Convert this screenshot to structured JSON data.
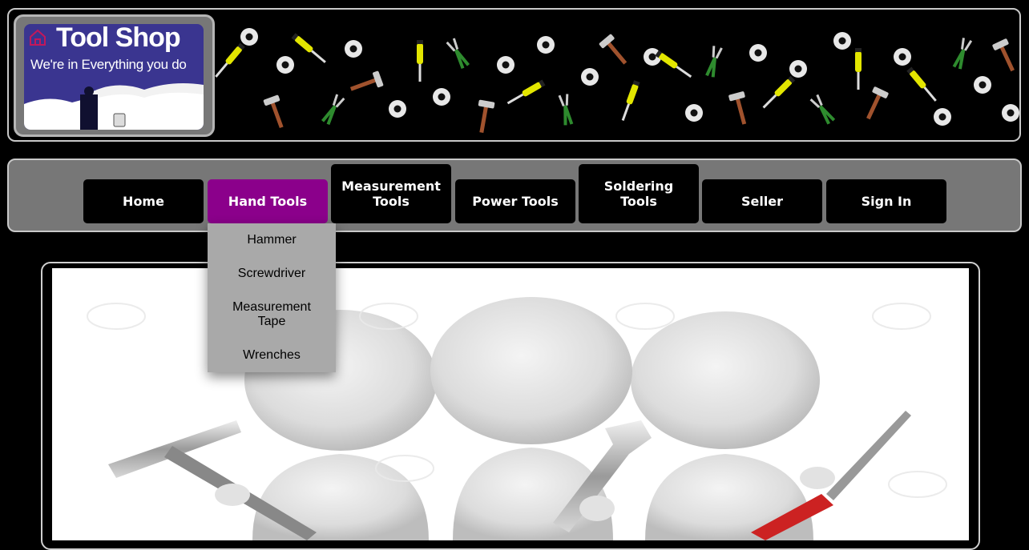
{
  "logo": {
    "title": "Tool Shop",
    "tagline": "We're in Everything you do"
  },
  "nav": {
    "items": [
      {
        "label": "Home"
      },
      {
        "label": "Hand Tools",
        "active": true
      },
      {
        "label_line1": "Measurement",
        "label_line2": "Tools"
      },
      {
        "label": "Power Tools"
      },
      {
        "label_line1": "Soldering",
        "label_line2": "Tools"
      },
      {
        "label": "Seller"
      },
      {
        "label": "Sign In"
      }
    ],
    "active_color": "#8b008b"
  },
  "dropdown": {
    "items": [
      {
        "label": "Hammer"
      },
      {
        "label_line1": "Measurement",
        "label_line2": "Tape"
      },
      {
        "label": "Screwdriver"
      },
      {
        "label": "Wrenches"
      }
    ]
  },
  "icons": {
    "banner": "tools-pattern",
    "hero": "figures-holding-tools"
  }
}
